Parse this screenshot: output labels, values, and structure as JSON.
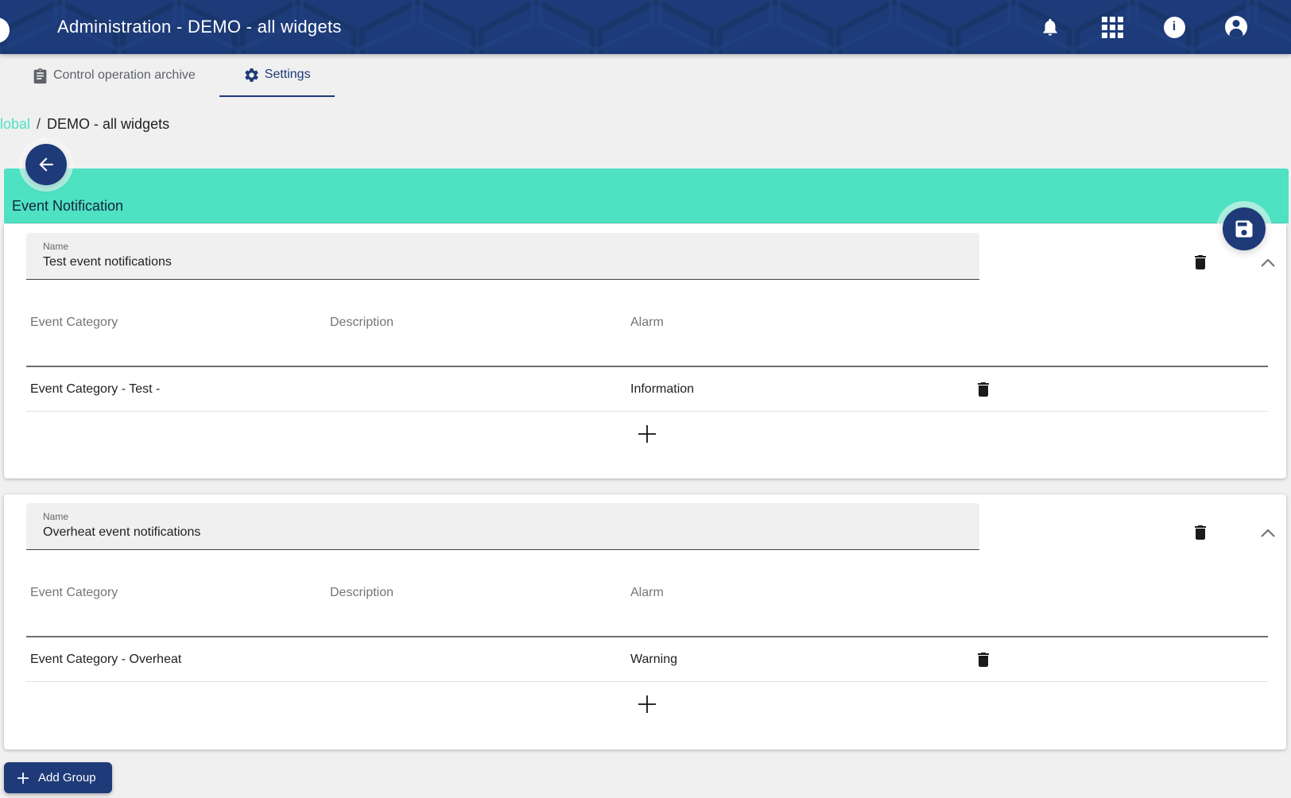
{
  "header": {
    "title": "Administration - DEMO - all widgets",
    "icons": [
      "notifications-bell",
      "apps-grid",
      "info",
      "account"
    ]
  },
  "tabs": [
    {
      "label": "Control operation archive",
      "icon": "clipboard",
      "active": false
    },
    {
      "label": "Settings",
      "icon": "gear",
      "active": true
    }
  ],
  "breadcrumb": {
    "root": "lobal",
    "separator": "/",
    "current": "DEMO - all widgets"
  },
  "section_title": "Event Notification",
  "groups": [
    {
      "name_label": "Name",
      "name_value": "Test event notifications",
      "columns": [
        "Event Category",
        "Description",
        "Alarm"
      ],
      "rows": [
        {
          "event_category": "Event Category - Test -",
          "description": "",
          "alarm": "Information"
        }
      ]
    },
    {
      "name_label": "Name",
      "name_value": "Overheat event notifications",
      "columns": [
        "Event Category",
        "Description",
        "Alarm"
      ],
      "rows": [
        {
          "event_category": "Event Category - Overheat",
          "description": "",
          "alarm": "Warning"
        }
      ]
    }
  ],
  "add_group": {
    "label": "Add Group"
  },
  "colors": {
    "header_navy": "#1d3b79",
    "accent_navy": "#1e3a78",
    "banner_teal": "#4ee2c2",
    "breadcrumb_link_teal": "#4ee2c1",
    "page_background": "#f0f0f1",
    "muted_text": "#757575",
    "dark_text": "#212121"
  }
}
